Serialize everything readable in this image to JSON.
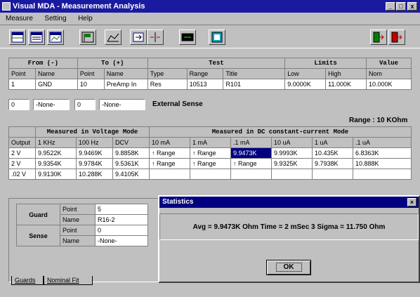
{
  "window": {
    "title": "Visual MDA - Measurement Analysis",
    "min": "_",
    "max": "□",
    "close": "x"
  },
  "menu": [
    "Measure",
    "Setting",
    "Help"
  ],
  "toolbar": {
    "icons": [
      "grid-icon",
      "list-icon",
      "chart-icon",
      "flag-icon",
      "move-icon",
      "split-icon",
      "display-icon",
      "screen-icon",
      "exit-icon",
      "exit2-icon"
    ]
  },
  "top_table": {
    "groups": [
      "From (-)",
      "To (+)",
      "Test",
      "Limits",
      "Value"
    ],
    "headers": [
      "Point",
      "Name",
      "Point",
      "Name",
      "Type",
      "Range",
      "Title",
      "Low",
      "High",
      "Nom"
    ],
    "row": [
      "1",
      "GND",
      "10",
      "PreAmp In",
      "Res",
      "10513",
      "R101",
      "9.0000K",
      "11.000K",
      "10.000K"
    ]
  },
  "sense": {
    "from_point": "0",
    "from_name": "-None-",
    "to_point": "0",
    "to_name": "-None-",
    "label": "External Sense"
  },
  "range_label": "Range : 10 KOhm",
  "mid_table": {
    "group_voltage": "Measured in Voltage Mode",
    "group_current": "Measured in DC constant-current Mode",
    "headers": [
      "Output",
      "1 KHz",
      "100 Hz",
      "DCV",
      "10 mA",
      "1 mA",
      ".1 mA",
      "10 uA",
      "1 uA",
      ".1 uA"
    ],
    "rows": [
      [
        "2 V",
        "9.9522K",
        "9.9469K",
        "9.8858K",
        "↑ Range",
        "↑ Range",
        "9.9473K",
        "9.9993K",
        "10.435K",
        "6.8363K"
      ],
      [
        "2 V",
        "9.9354K",
        "9.9784K",
        "9.5361K",
        "↑ Range",
        "↑ Range",
        "↑ Range",
        "9.9325K",
        "9.7938K",
        "10.888K"
      ],
      [
        ".02 V",
        "9.9130K",
        "10.288K",
        "9.4105K",
        "",
        "",
        "",
        "",
        "",
        ""
      ]
    ]
  },
  "guard_sense": {
    "guard_label": "Guard",
    "sense_label": "Sense",
    "point_label": "Point",
    "name_label": "Name",
    "guard_point": "5",
    "guard_name": "R16-2",
    "sense_point": "0",
    "sense_name": "-None-"
  },
  "tabs": [
    "Guards",
    "Nominal Fit"
  ],
  "dialog": {
    "title": "Statistics",
    "message": "Avg = 9.9473K Ohm    Time = 2 mSec    3 Sigma = 11.750 Ohm",
    "ok": "OK"
  }
}
